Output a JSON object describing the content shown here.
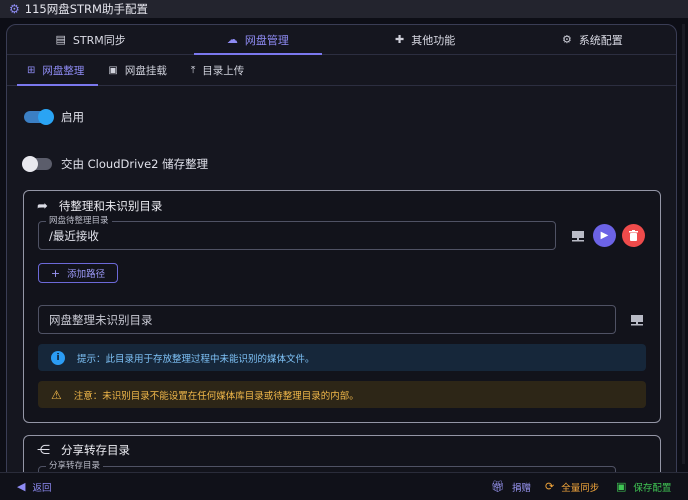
{
  "app": {
    "title": "115网盘STRM助手配置"
  },
  "main_tabs": [
    {
      "label": "STRM同步",
      "icon": "file-icon"
    },
    {
      "label": "网盘管理",
      "icon": "cloud-icon"
    },
    {
      "label": "其他功能",
      "icon": "puzzle-icon"
    },
    {
      "label": "系统配置",
      "icon": "gear-icon"
    }
  ],
  "sub_tabs": [
    {
      "label": "网盘整理",
      "icon": "sitemap-icon"
    },
    {
      "label": "网盘挂载",
      "icon": "monitor-icon"
    },
    {
      "label": "目录上传",
      "icon": "upload-icon"
    }
  ],
  "toggles": [
    {
      "label": "启用",
      "on": true
    },
    {
      "label": "交由 CloudDrive2 储存整理",
      "on": false
    }
  ],
  "pending_card": {
    "title": "待整理和未识别目录",
    "path_field": {
      "legend": "网盘待整理目录",
      "value": "/最近接收"
    },
    "add_path_label": "添加路径",
    "unrecognized_field": {
      "placeholder": "网盘整理未识别目录"
    },
    "info_alert": "提示：此目录用于存放整理过程中未能识别的媒体文件。",
    "warn_alert": "注意：未识别目录不能设置在任何媒体库目录或待整理目录的内部。"
  },
  "share_card": {
    "title": "分享转存目录",
    "field_legend": "分享转存目录"
  },
  "footer": {
    "back_label": "返回",
    "donate_label": "捐赠",
    "sync_label": "全量同步",
    "save_label": "保存配置"
  },
  "colors": {
    "accent": "#7b78ee",
    "run_button": "#6c63e6",
    "delete_button": "#ef4b4b",
    "footer_green": "#3fc553",
    "footer_orange": "#f0a43a"
  }
}
